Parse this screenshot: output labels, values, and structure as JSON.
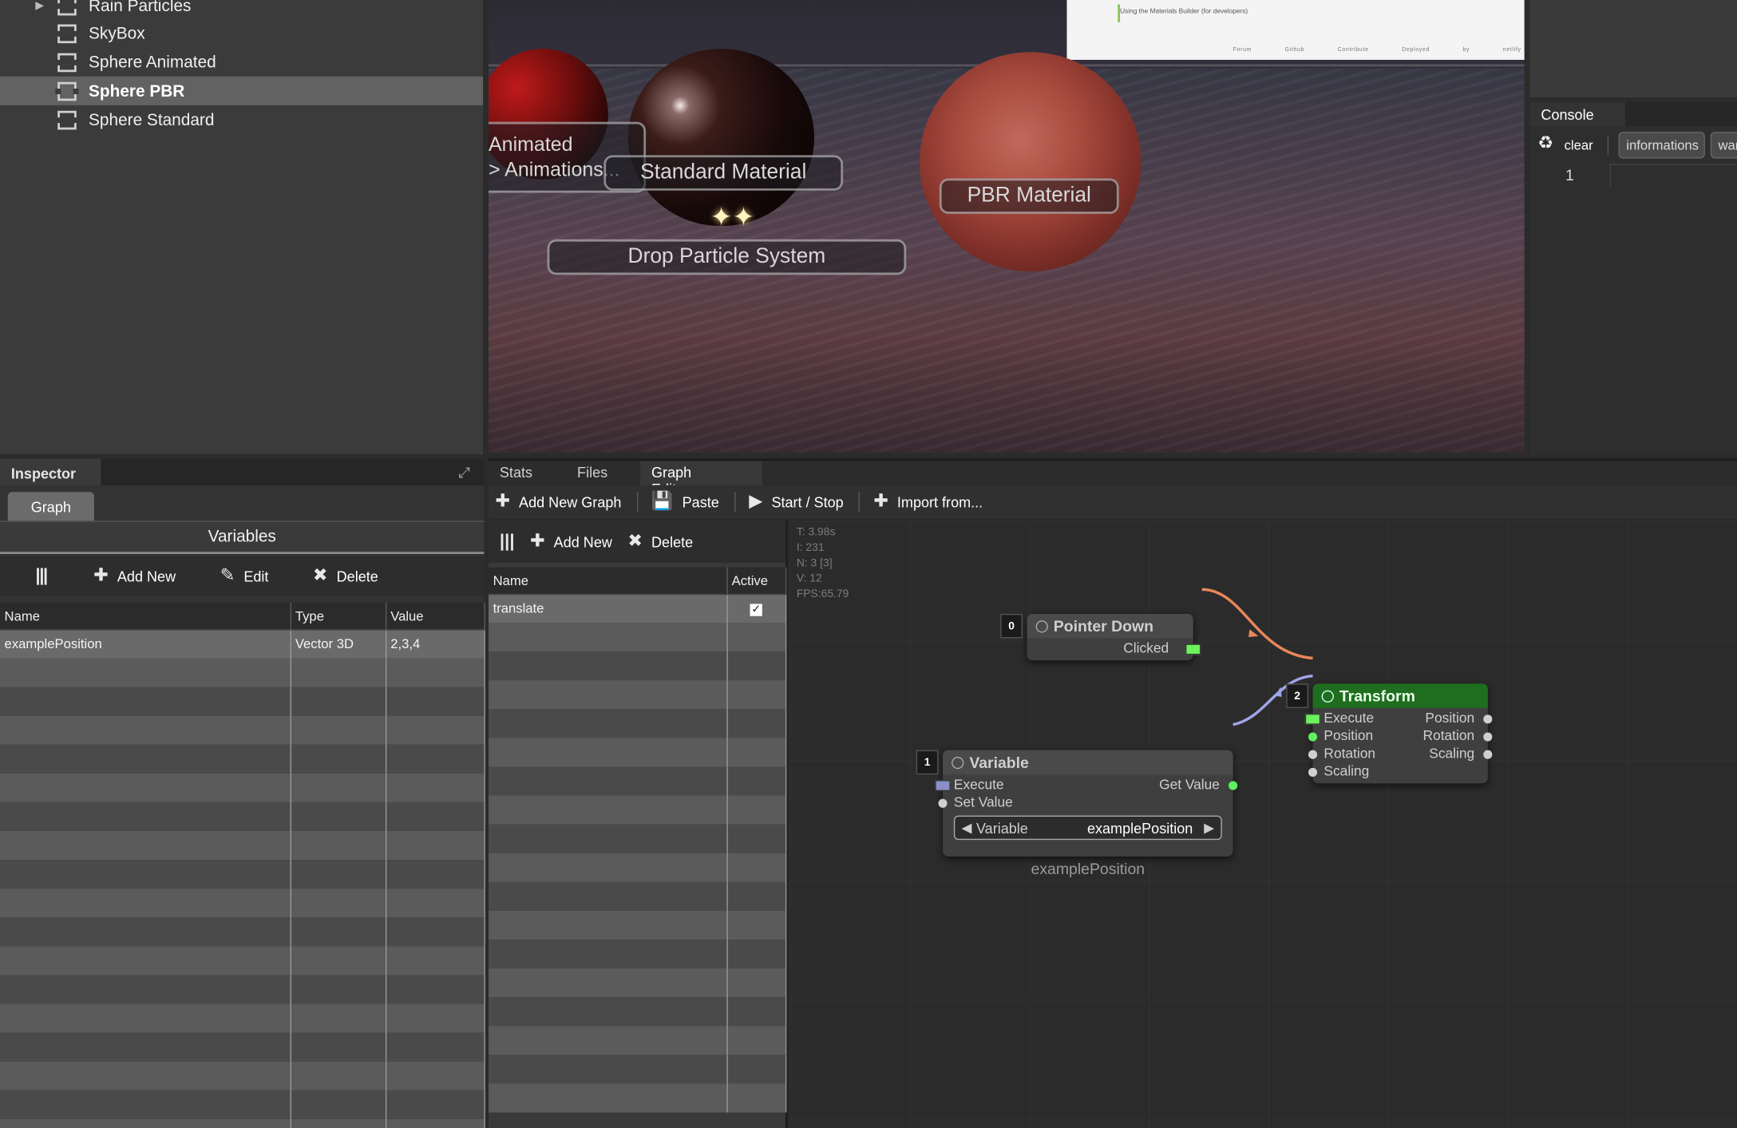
{
  "scene_tree": {
    "items": [
      {
        "label": "Rain Particles",
        "has_children": true,
        "selected": false
      },
      {
        "label": "SkyBox",
        "has_children": false,
        "selected": false
      },
      {
        "label": "Sphere Animated",
        "has_children": false,
        "selected": false
      },
      {
        "label": "Sphere PBR",
        "has_children": false,
        "selected": true
      },
      {
        "label": "Sphere Standard",
        "has_children": false,
        "selected": false
      }
    ]
  },
  "viewport": {
    "labels": {
      "animated_line1": "Animated",
      "animated_line2": "> Animations...",
      "standard": "Standard Material",
      "pbr": "PBR Material",
      "particles": "Drop Particle System"
    },
    "doc_panel": {
      "line": "Using the Materials Builder (for developers)",
      "footer": "Forum Github Contribute Deployed by netlify"
    },
    "particle_icon": "sparkle-icon"
  },
  "console": {
    "title": "Console",
    "clear_label": "clear",
    "filters": [
      "informations",
      "warnings"
    ],
    "line_number": "1"
  },
  "inspector": {
    "title": "Inspector",
    "tab": "Graph",
    "section_title": "Variables",
    "toolbar": {
      "add_new": "Add New",
      "edit": "Edit",
      "delete": "Delete"
    },
    "columns": [
      "Name",
      "Type",
      "Value"
    ],
    "rows": [
      {
        "name": "examplePosition",
        "type": "Vector 3D",
        "value": "2,3,4"
      }
    ]
  },
  "graph_editor": {
    "tabs": [
      {
        "label": "Stats",
        "active": false
      },
      {
        "label": "Files",
        "active": false
      },
      {
        "label": "Graph Editor",
        "active": true,
        "closable": true
      }
    ],
    "toolbar": {
      "add_new_graph": "Add New Graph",
      "paste": "Paste",
      "start_stop": "Start / Stop",
      "import_from": "Import from..."
    },
    "list": {
      "toolbar": {
        "add_new": "Add New",
        "delete": "Delete"
      },
      "columns": [
        "Name",
        "Active"
      ],
      "rows": [
        {
          "name": "translate",
          "active": true
        }
      ]
    },
    "stats": {
      "t": "T: 3.98s",
      "i": "I: 231",
      "n": "N: 3 [3]",
      "v": "V: 12",
      "fps": "FPS:65.79"
    },
    "nodes": {
      "pointer_down": {
        "id": "0",
        "title": "Pointer Down",
        "output": "Clicked"
      },
      "variable": {
        "id": "1",
        "title": "Variable",
        "inputs": [
          "Execute",
          "Set Value"
        ],
        "output": "Get Value",
        "selector_label": "Variable",
        "selector_value": "examplePosition",
        "caption": "examplePosition"
      },
      "transform": {
        "id": "2",
        "title": "Transform",
        "inputs": [
          "Execute",
          "Position",
          "Rotation",
          "Scaling"
        ],
        "outputs": [
          "Position",
          "Rotation",
          "Scaling"
        ]
      }
    },
    "colors": {
      "transform_header": "#1f6d1f",
      "exec_link": "#e8875a",
      "value_link": "#9fa4e8",
      "exec_port": "#6cf25c"
    }
  }
}
